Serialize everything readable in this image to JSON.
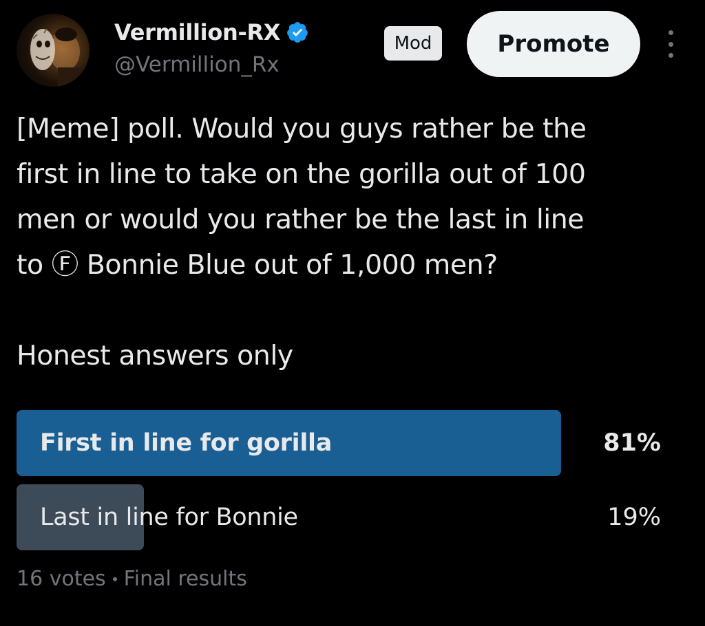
{
  "post": {
    "author": {
      "display_name": "Vermillion-RX",
      "handle": "@Vermillion_Rx",
      "verified": true,
      "avatar": "avatar-masked-person"
    },
    "badge": "Mod",
    "promote_label": "Promote",
    "more_icon": "more-vertical-icon",
    "text_lines": [
      "[Meme] poll. Would you guys rather be the",
      "first in line to take on the gorilla out of 100",
      "men or would you rather be the last in line",
      "to Ⓕ Bonnie Blue out of 1,000 men?"
    ],
    "subtext": "Honest answers only"
  },
  "poll": {
    "options": [
      {
        "label": "First in line for gorilla",
        "percent_text": "81%",
        "percent": 81,
        "winner": true
      },
      {
        "label": "Last in line for Bonnie",
        "percent_text": "19%",
        "percent": 19,
        "winner": false
      }
    ],
    "votes": "16 votes",
    "status": "Final results"
  },
  "colors": {
    "background": "#000000",
    "winner_bar": "#1a5f94",
    "other_bar": "#3d4a58",
    "verified_blue": "#1d9bf0",
    "muted_text": "#71767b",
    "primary_text": "#e7e9ea"
  }
}
